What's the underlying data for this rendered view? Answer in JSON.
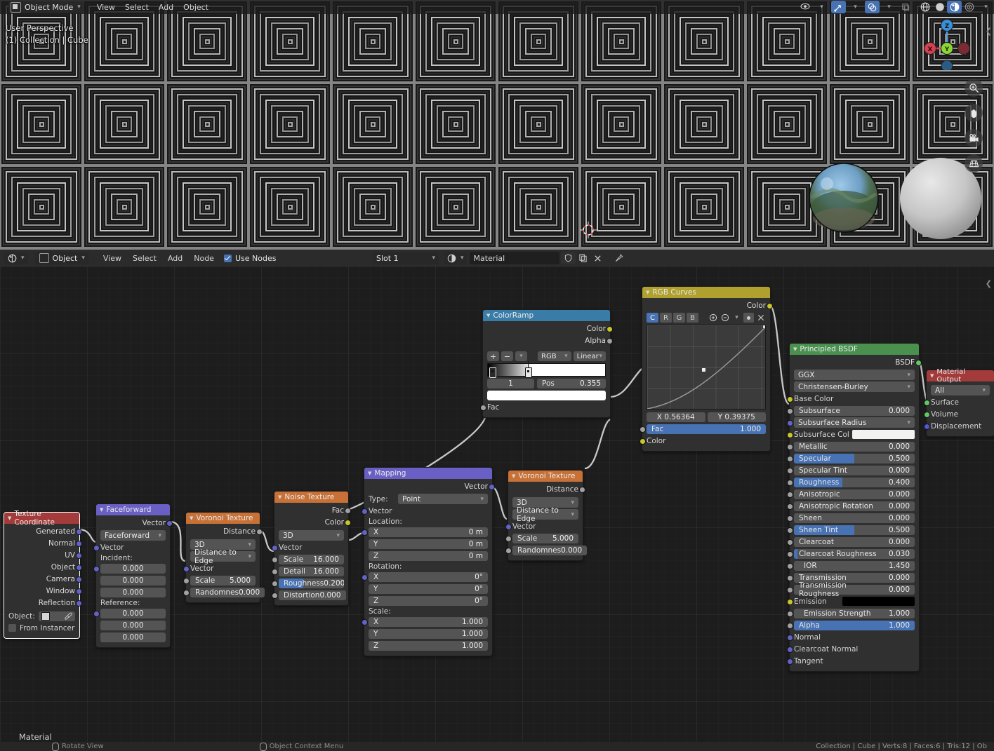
{
  "viewport": {
    "mode": "Object Mode",
    "menus": [
      "View",
      "Select",
      "Add",
      "Object"
    ],
    "overlay_text_line1": "User Perspective",
    "overlay_text_line2": "(1) Collection | Cube",
    "gizmo_axes": [
      "X",
      "Y",
      "Z"
    ],
    "tools": [
      "zoom-icon",
      "hand-icon",
      "camera-icon",
      "grid-icon"
    ],
    "right_icons": [
      "visibility-icon",
      "gizmo-icon",
      "overlays-icon",
      "xray-icon",
      "shading-wireframe-icon",
      "shading-solid-icon",
      "shading-material-icon",
      "shading-rendered-icon"
    ]
  },
  "node_editor": {
    "editor_type": "shader-editor-icon",
    "shader_type": "Object",
    "menus": [
      "View",
      "Select",
      "Add",
      "Node"
    ],
    "use_nodes_label": "Use Nodes",
    "slot": "Slot 1",
    "material_name": "Material",
    "header_icons": [
      "shield-icon",
      "copy-icon",
      "unlink-icon",
      "pin-icon"
    ],
    "footer_label": "Material"
  },
  "nodes": {
    "texture_coordinate": {
      "title": "Texture Coordinate",
      "outputs": [
        "Generated",
        "Normal",
        "UV",
        "Object",
        "Camera",
        "Window",
        "Reflection"
      ],
      "object_label": "Object:",
      "from_instancer_label": "From Instancer"
    },
    "faceforward": {
      "title": "Faceforward",
      "output": "Vector",
      "operation": "Faceforward",
      "vector_label": "Vector",
      "incident_label": "Incident:",
      "incident": [
        "0.000",
        "0.000",
        "0.000"
      ],
      "reference_label": "Reference:",
      "reference": [
        "0.000",
        "0.000",
        "0.000"
      ]
    },
    "voronoi_left": {
      "title": "Voronoi Texture",
      "output": "Distance",
      "dimension": "3D",
      "feature": "Distance to Edge",
      "vector_label": "Vector",
      "params": [
        {
          "label": "Scale",
          "value": "5.000"
        },
        {
          "label": "Randomnes",
          "value": "0.000"
        }
      ]
    },
    "noise_texture": {
      "title": "Noise Texture",
      "outputs": [
        "Fac",
        "Color"
      ],
      "dimension": "3D",
      "vector_label": "Vector",
      "params": [
        {
          "label": "Scale",
          "value": "16.000",
          "fill": 0
        },
        {
          "label": "Detail",
          "value": "16.000",
          "fill": 0
        },
        {
          "label": "Roughness",
          "value": "0.200",
          "fill": 38
        },
        {
          "label": "Distortion",
          "value": "0.000",
          "fill": 0
        }
      ]
    },
    "mapping": {
      "title": "Mapping",
      "output": "Vector",
      "type_label": "Type:",
      "type_value": "Point",
      "vector_label": "Vector",
      "location_label": "Location:",
      "location": [
        {
          "axis": "X",
          "value": "0 m"
        },
        {
          "axis": "Y",
          "value": "0 m"
        },
        {
          "axis": "Z",
          "value": "0 m"
        }
      ],
      "rotation_label": "Rotation:",
      "rotation": [
        {
          "axis": "X",
          "value": "0°"
        },
        {
          "axis": "Y",
          "value": "0°"
        },
        {
          "axis": "Z",
          "value": "0°"
        }
      ],
      "scale_label": "Scale:",
      "scale": [
        {
          "axis": "X",
          "value": "1.000"
        },
        {
          "axis": "Y",
          "value": "1.000"
        },
        {
          "axis": "Z",
          "value": "1.000"
        }
      ]
    },
    "voronoi_right": {
      "title": "Voronoi Texture",
      "output": "Distance",
      "dimension": "3D",
      "feature": "Distance to Edge",
      "vector_label": "Vector",
      "params": [
        {
          "label": "Scale",
          "value": "5.000"
        },
        {
          "label": "Randomnes",
          "value": "0.000"
        }
      ]
    },
    "colorramp": {
      "title": "ColorRamp",
      "outputs": [
        "Color",
        "Alpha"
      ],
      "buttons": [
        "+",
        "−",
        "∨"
      ],
      "color_mode": "RGB",
      "interpolation": "Linear",
      "index": "1",
      "pos_label": "Pos",
      "pos_value": "0.355",
      "selected_color": "#ffffff",
      "input": "Fac"
    },
    "rgb_curves": {
      "title": "RGB Curves",
      "output": "Color",
      "channel_tabs": [
        "C",
        "R",
        "G",
        "B"
      ],
      "active_channel": "C",
      "tool_icons": [
        "zoom-in-icon",
        "zoom-out-icon",
        "chevron-down-icon",
        "clipping-icon",
        "delete-icon"
      ],
      "coord_x": "X 0.56364",
      "coord_y": "Y 0.39375",
      "fac_label": "Fac",
      "fac_value": "1.000",
      "color_label": "Color"
    },
    "principled_bsdf": {
      "title": "Principled BSDF",
      "output": "BSDF",
      "distribution": "GGX",
      "subsurface_method": "Christensen-Burley",
      "base_color_label": "Base Color",
      "subsurface_radius_label": "Subsurface Radius",
      "subsurface_col_label": "Subsurface Col",
      "subsurface_col_value": "#f2f2f0",
      "emission_label": "Emission",
      "emission_color": "#000000",
      "params": [
        {
          "label": "Subsurface",
          "value": "0.000",
          "fill": 0
        },
        {
          "label": "Metallic",
          "value": "0.000",
          "fill": 0
        },
        {
          "label": "Specular",
          "value": "0.500",
          "fill": 50
        },
        {
          "label": "Specular Tint",
          "value": "0.000",
          "fill": 0
        },
        {
          "label": "Roughness",
          "value": "0.400",
          "fill": 40
        },
        {
          "label": "Anisotropic",
          "value": "0.000",
          "fill": 0
        },
        {
          "label": "Anisotropic Rotation",
          "value": "0.000",
          "fill": 0
        },
        {
          "label": "Sheen",
          "value": "0.000",
          "fill": 0
        },
        {
          "label": "Sheen Tint",
          "value": "0.500",
          "fill": 50
        },
        {
          "label": "Clearcoat",
          "value": "0.000",
          "fill": 0
        },
        {
          "label": "Clearcoat Roughness",
          "value": "0.030",
          "fill": 3
        },
        {
          "label": "IOR",
          "value": "1.450",
          "fill": 0
        },
        {
          "label": "Transmission",
          "value": "0.000",
          "fill": 0
        },
        {
          "label": "Transmission Roughness",
          "value": "0.000",
          "fill": 0
        },
        {
          "label": "Emission Strength",
          "value": "1.000",
          "fill": 0
        },
        {
          "label": "Alpha",
          "value": "1.000",
          "fill": 100
        }
      ],
      "vector_inputs": [
        "Normal",
        "Clearcoat Normal",
        "Tangent"
      ]
    },
    "material_output": {
      "title": "Material Output",
      "target": "All",
      "inputs": [
        "Surface",
        "Volume",
        "Displacement"
      ]
    }
  },
  "statusbar": {
    "items": [
      "Rotate View",
      "Object Context Menu"
    ],
    "scene_stats": "Collection | Cube | Verts:8 | Faces:6 | Tris:12 | Ob"
  }
}
